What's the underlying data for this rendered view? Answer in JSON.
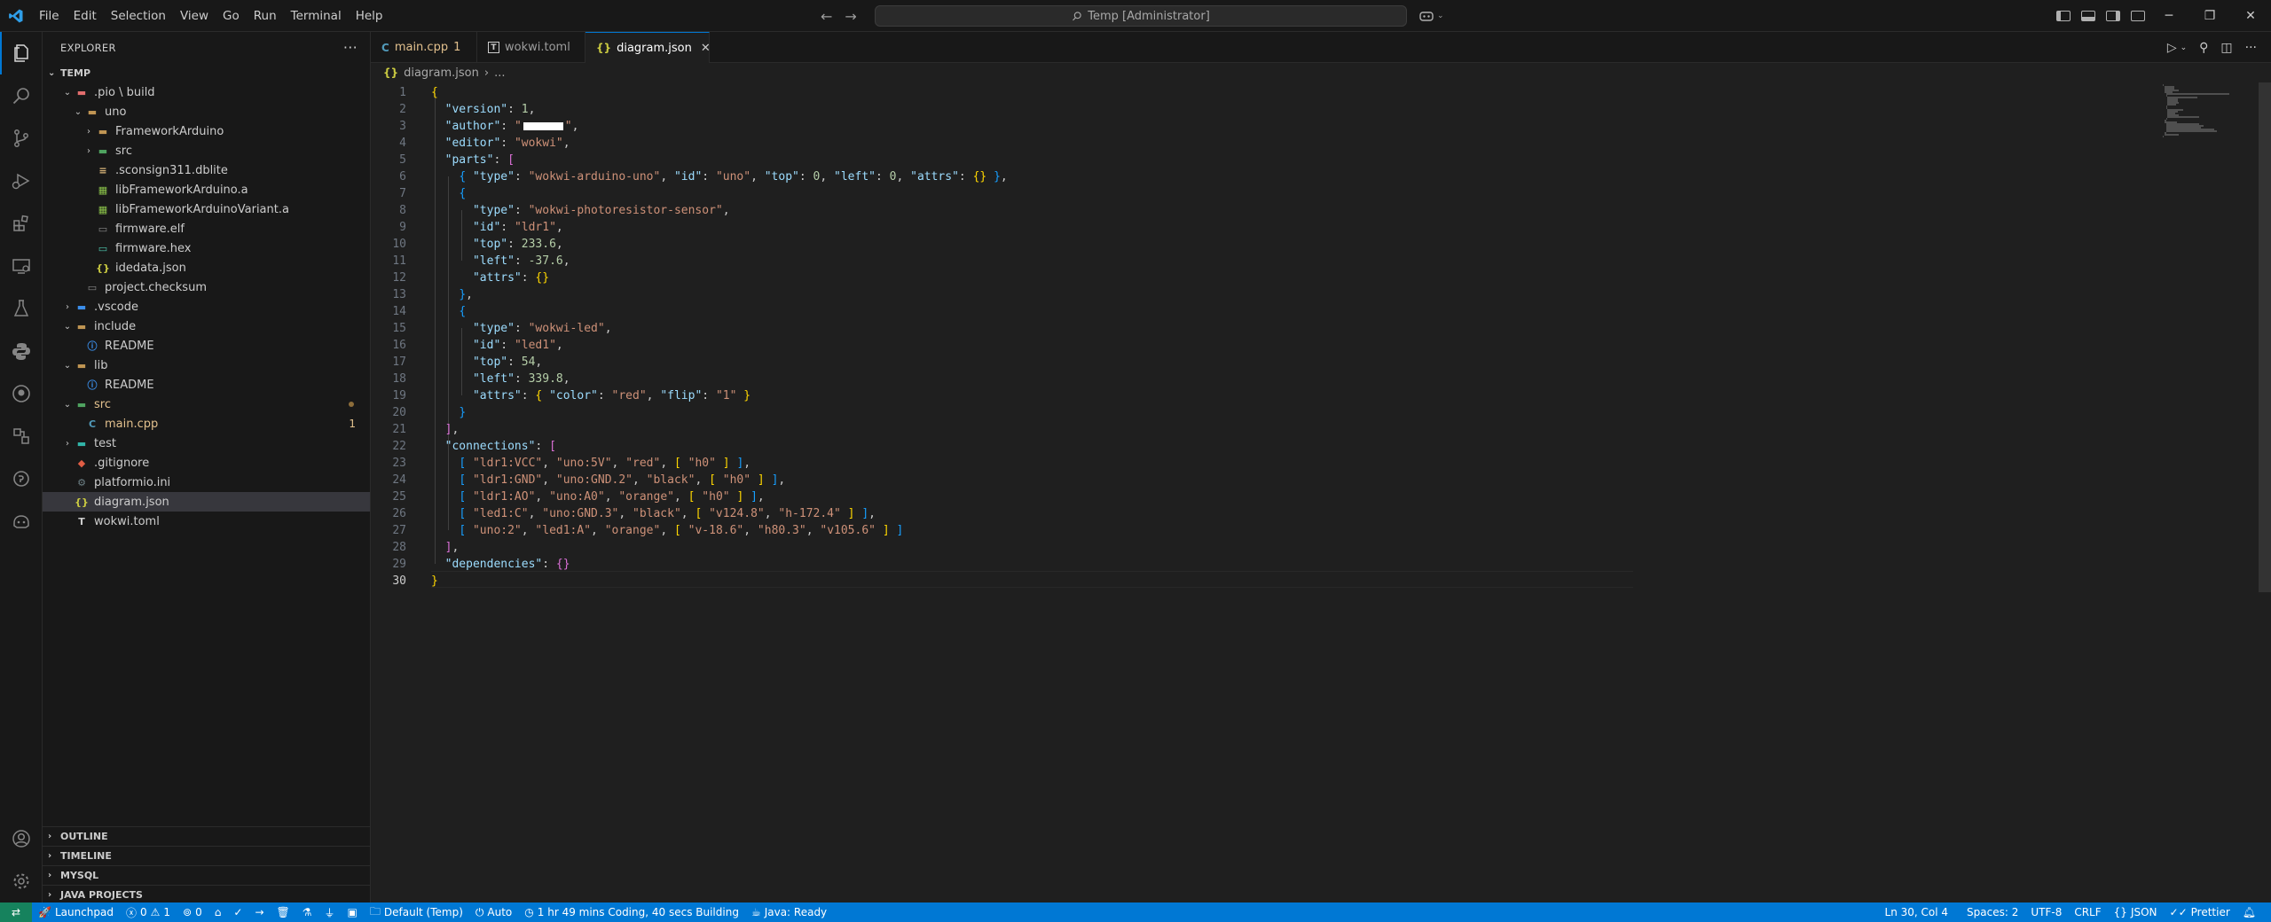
{
  "menu": [
    "File",
    "Edit",
    "Selection",
    "View",
    "Go",
    "Run",
    "Terminal",
    "Help"
  ],
  "command_center": "Temp [Administrator]",
  "sidebar": {
    "title": "EXPLORER",
    "workspace": "TEMP",
    "tree": [
      {
        "label": ".pio \\ build",
        "depth": 1,
        "type": "folder-pio",
        "chev": "v"
      },
      {
        "label": "uno",
        "depth": 2,
        "type": "folder",
        "chev": "v"
      },
      {
        "label": "FrameworkArduino",
        "depth": 3,
        "type": "folder",
        "chev": ">"
      },
      {
        "label": "src",
        "depth": 3,
        "type": "folder-src",
        "chev": ">"
      },
      {
        "label": ".sconsign311.dblite",
        "depth": 3,
        "type": "db"
      },
      {
        "label": "libFrameworkArduino.a",
        "depth": 3,
        "type": "lib"
      },
      {
        "label": "libFrameworkArduinoVariant.a",
        "depth": 3,
        "type": "lib"
      },
      {
        "label": "firmware.elf",
        "depth": 3,
        "type": "file"
      },
      {
        "label": "firmware.hex",
        "depth": 3,
        "type": "hex"
      },
      {
        "label": "idedata.json",
        "depth": 3,
        "type": "json"
      },
      {
        "label": "project.checksum",
        "depth": 2,
        "type": "file"
      },
      {
        "label": ".vscode",
        "depth": 1,
        "type": "folder-vscode",
        "chev": ">"
      },
      {
        "label": "include",
        "depth": 1,
        "type": "folder",
        "chev": "v"
      },
      {
        "label": "README",
        "depth": 2,
        "type": "info"
      },
      {
        "label": "lib",
        "depth": 1,
        "type": "folder",
        "chev": "v"
      },
      {
        "label": "README",
        "depth": 2,
        "type": "info"
      },
      {
        "label": "src",
        "depth": 1,
        "type": "folder-src",
        "chev": "v",
        "modified": true
      },
      {
        "label": "main.cpp",
        "depth": 2,
        "type": "cpp",
        "badge": "1"
      },
      {
        "label": "test",
        "depth": 1,
        "type": "folder-test",
        "chev": ">"
      },
      {
        "label": ".gitignore",
        "depth": 1,
        "type": "git"
      },
      {
        "label": "platformio.ini",
        "depth": 1,
        "type": "gear"
      },
      {
        "label": "diagram.json",
        "depth": 1,
        "type": "json",
        "selected": true
      },
      {
        "label": "wokwi.toml",
        "depth": 1,
        "type": "toml"
      }
    ],
    "bottom_sections": [
      "OUTLINE",
      "TIMELINE",
      "MYSQL",
      "JAVA PROJECTS"
    ]
  },
  "tabs": [
    {
      "label": "main.cpp",
      "badge": "1",
      "icon": "cpp-icon"
    },
    {
      "label": "wokwi.toml",
      "icon": "toml-icon"
    },
    {
      "label": "diagram.json",
      "icon": "json-icon",
      "active": true
    }
  ],
  "breadcrumb": {
    "file": "diagram.json",
    "more": "..."
  },
  "code_lines": [
    "<span class='b1'>{</span>",
    "  <span class='k'>\"version\"</span>: <span class='n'>1</span>,",
    "  <span class='k'>\"author\"</span>: <span class='s'>\"</span><span class='redact'></span><span class='s'>\"</span>,",
    "  <span class='k'>\"editor\"</span>: <span class='s'>\"wokwi\"</span>,",
    "  <span class='k'>\"parts\"</span>: <span class='b2'>[</span>",
    "    <span class='b3'>{</span> <span class='k'>\"type\"</span>: <span class='s'>\"wokwi-arduino-uno\"</span>, <span class='k'>\"id\"</span>: <span class='s'>\"uno\"</span>, <span class='k'>\"top\"</span>: <span class='n'>0</span>, <span class='k'>\"left\"</span>: <span class='n'>0</span>, <span class='k'>\"attrs\"</span>: <span class='b1'>{}</span> <span class='b3'>}</span>,",
    "    <span class='b3'>{</span>",
    "      <span class='k'>\"type\"</span>: <span class='s'>\"wokwi-photoresistor-sensor\"</span>,",
    "      <span class='k'>\"id\"</span>: <span class='s'>\"ldr1\"</span>,",
    "      <span class='k'>\"top\"</span>: <span class='n'>233.6</span>,",
    "      <span class='k'>\"left\"</span>: <span class='n'>-37.6</span>,",
    "      <span class='k'>\"attrs\"</span>: <span class='b1'>{}</span>",
    "    <span class='b3'>}</span>,",
    "    <span class='b3'>{</span>",
    "      <span class='k'>\"type\"</span>: <span class='s'>\"wokwi-led\"</span>,",
    "      <span class='k'>\"id\"</span>: <span class='s'>\"led1\"</span>,",
    "      <span class='k'>\"top\"</span>: <span class='n'>54</span>,",
    "      <span class='k'>\"left\"</span>: <span class='n'>339.8</span>,",
    "      <span class='k'>\"attrs\"</span>: <span class='b1'>{</span> <span class='k'>\"color\"</span>: <span class='s'>\"red\"</span>, <span class='k'>\"flip\"</span>: <span class='s'>\"1\"</span> <span class='b1'>}</span>",
    "    <span class='b3'>}</span>",
    "  <span class='b2'>]</span>,",
    "  <span class='k'>\"connections\"</span>: <span class='b2'>[</span>",
    "    <span class='b3'>[</span> <span class='s'>\"ldr1:VCC\"</span>, <span class='s'>\"uno:5V\"</span>, <span class='s'>\"red\"</span>, <span class='b1'>[</span> <span class='s'>\"h0\"</span> <span class='b1'>]</span> <span class='b3'>]</span>,",
    "    <span class='b3'>[</span> <span class='s'>\"ldr1:GND\"</span>, <span class='s'>\"uno:GND.2\"</span>, <span class='s'>\"black\"</span>, <span class='b1'>[</span> <span class='s'>\"h0\"</span> <span class='b1'>]</span> <span class='b3'>]</span>,",
    "    <span class='b3'>[</span> <span class='s'>\"ldr1:AO\"</span>, <span class='s'>\"uno:A0\"</span>, <span class='s'>\"orange\"</span>, <span class='b1'>[</span> <span class='s'>\"h0\"</span> <span class='b1'>]</span> <span class='b3'>]</span>,",
    "    <span class='b3'>[</span> <span class='s'>\"led1:C\"</span>, <span class='s'>\"uno:GND.3\"</span>, <span class='s'>\"black\"</span>, <span class='b1'>[</span> <span class='s'>\"v124.8\"</span>, <span class='s'>\"h-172.4\"</span> <span class='b1'>]</span> <span class='b3'>]</span>,",
    "    <span class='b3'>[</span> <span class='s'>\"uno:2\"</span>, <span class='s'>\"led1:A\"</span>, <span class='s'>\"orange\"</span>, <span class='b1'>[</span> <span class='s'>\"v-18.6\"</span>, <span class='s'>\"h80.3\"</span>, <span class='s'>\"v105.6\"</span> <span class='b1'>]</span> <span class='b3'>]</span>",
    "  <span class='b2'>]</span>,",
    "  <span class='k'>\"dependencies\"</span>: <span class='b2'>{}</span>",
    "<span class='b1'>}</span>"
  ],
  "status": {
    "launchpad": "Launchpad",
    "errors": "0",
    "warnings": "1",
    "ports": "0",
    "env": "Default (Temp)",
    "auto": "Auto",
    "coding": "1 hr 49 mins Coding, 40 secs Building",
    "java": "Java: Ready",
    "position": "Ln 30, Col 4",
    "spaces": "Spaces: 2",
    "encoding": "UTF-8",
    "eol": "CRLF",
    "language": "JSON",
    "prettier": "Prettier"
  },
  "colors": {
    "accent": "#0078d4",
    "statusbar": "#0078d4",
    "remote": "#16825d"
  }
}
